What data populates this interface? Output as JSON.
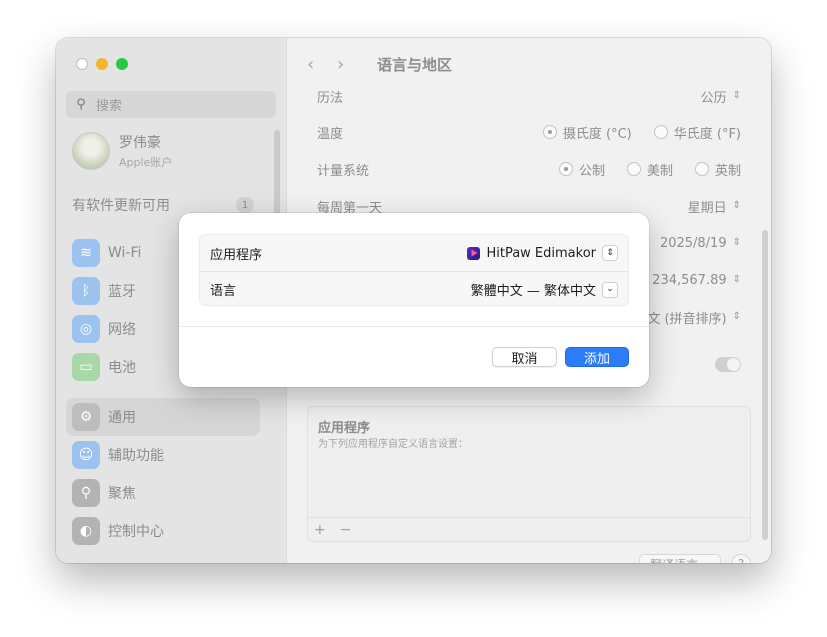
{
  "sidebar": {
    "search_placeholder": "搜索",
    "account": {
      "name": "罗伟豪",
      "subtitle": "Apple账户"
    },
    "updates": {
      "label": "有软件更新可用",
      "count": "1"
    },
    "items": [
      {
        "label": "Wi-Fi",
        "icon": "wifi-icon"
      },
      {
        "label": "蓝牙",
        "icon": "bluetooth-icon"
      },
      {
        "label": "网络",
        "icon": "globe-icon"
      },
      {
        "label": "电池",
        "icon": "battery-icon"
      },
      {
        "label": "通用",
        "icon": "gear-icon",
        "active": true
      },
      {
        "label": "辅助功能",
        "icon": "accessibility-icon"
      },
      {
        "label": "聚焦",
        "icon": "spotlight-icon"
      },
      {
        "label": "控制中心",
        "icon": "control-center-icon"
      }
    ]
  },
  "main": {
    "title": "语言与地区",
    "rows": {
      "calendar": {
        "label": "历法",
        "value": "公历"
      },
      "temperature": {
        "label": "温度",
        "opt1": "摄氏度 (°C)",
        "opt2": "华氏度 (°F)"
      },
      "measure": {
        "label": "计量系统",
        "opt1": "公制",
        "opt2": "美制",
        "opt3": "英制"
      },
      "first_day": {
        "label": "每周第一天",
        "value": "星期日"
      },
      "date_value": "2025/8/19",
      "number_value": "234,567.89",
      "sort_value": "文 (拼音排序)"
    },
    "apps": {
      "title": "应用程序",
      "subtitle": "为下列应用程序自定义语言设置："
    },
    "bottom_button": "翻译语言…",
    "help": "?"
  },
  "dialog": {
    "app_label": "应用程序",
    "app_value": "HitPaw Edimakor",
    "lang_label": "语言",
    "lang_value": "繁體中文 — 繁体中文",
    "cancel": "取消",
    "add": "添加"
  },
  "colors": {
    "accent": "#2b7cf6"
  }
}
